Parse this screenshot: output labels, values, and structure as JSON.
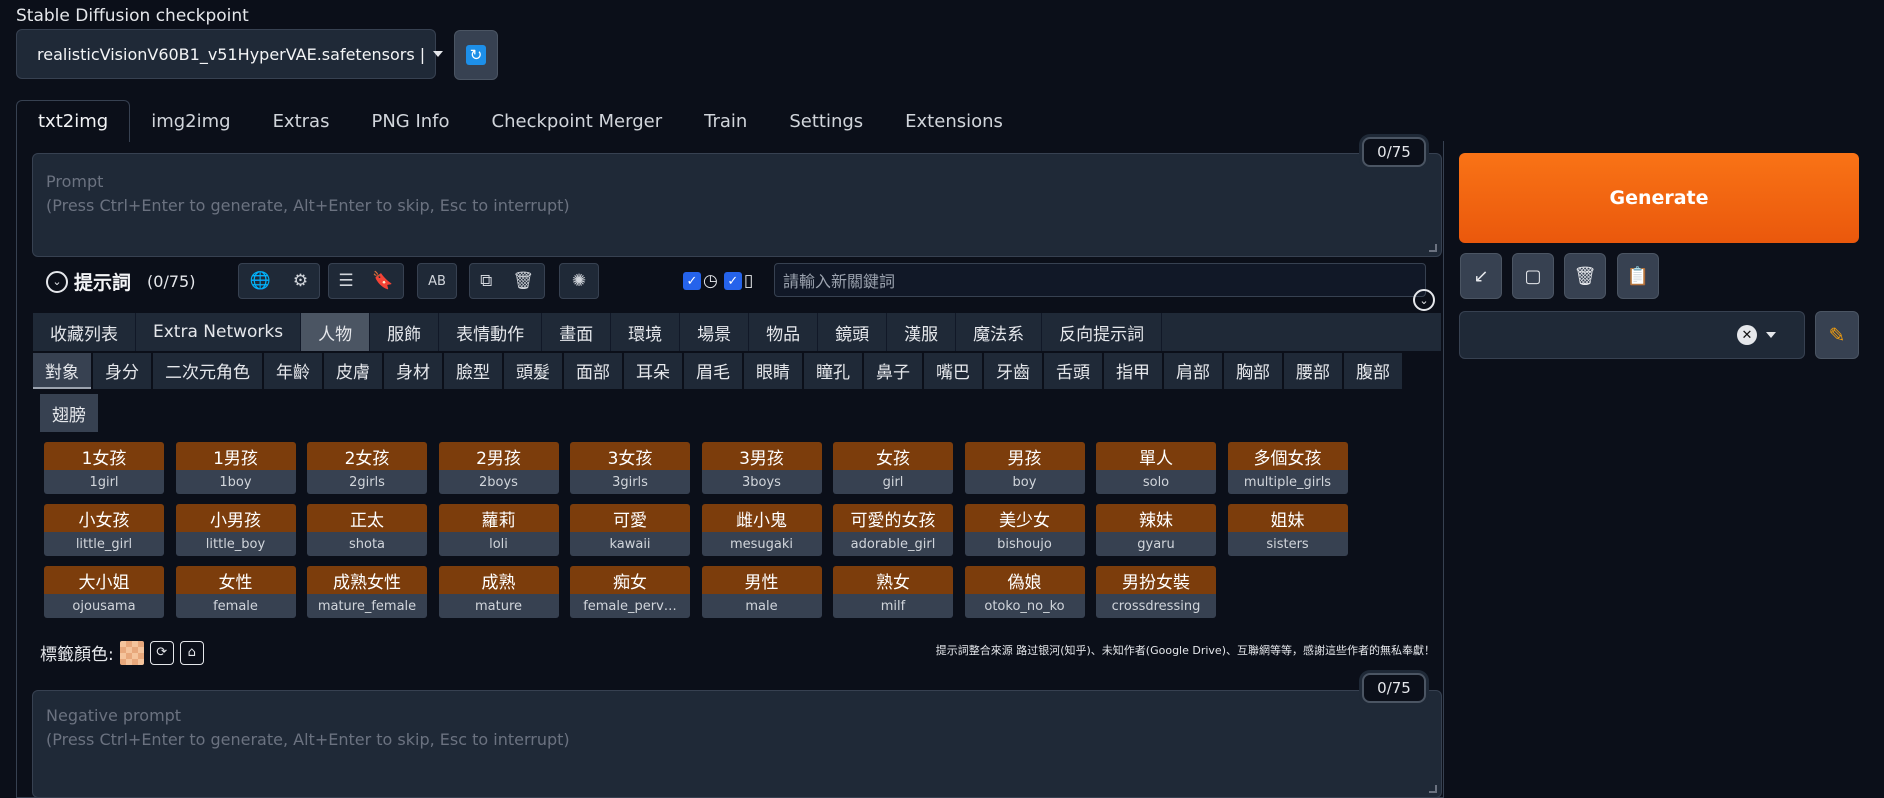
{
  "checkpoint": {
    "label": "Stable Diffusion checkpoint",
    "value": "realisticVisionV60B1_v51HyperVAE.safetensors |"
  },
  "tabs": [
    {
      "label": "txt2img",
      "active": true
    },
    {
      "label": "img2img"
    },
    {
      "label": "Extras"
    },
    {
      "label": "PNG Info"
    },
    {
      "label": "Checkpoint Merger"
    },
    {
      "label": "Train"
    },
    {
      "label": "Settings"
    },
    {
      "label": "Extensions"
    }
  ],
  "prompt": {
    "label": "Prompt",
    "hint": "(Press Ctrl+Enter to generate, Alt+Enter to skip, Esc to interrupt)",
    "counter": "0/75"
  },
  "negative_prompt": {
    "label": "Negative prompt",
    "hint": "(Press Ctrl+Enter to generate, Alt+Enter to skip, Esc to interrupt)",
    "counter": "0/75"
  },
  "generate_label": "Generate",
  "prompt_tools": {
    "title": "提示詞",
    "count": "(0/75)",
    "keyword_placeholder": "請輸入新關鍵詞"
  },
  "categories": [
    "收藏列表",
    "Extra Networks",
    "人物",
    "服飾",
    "表情動作",
    "畫面",
    "環境",
    "場景",
    "物品",
    "鏡頭",
    "漢服",
    "魔法系",
    "反向提示詞"
  ],
  "active_category": "人物",
  "subcategories": [
    "對象",
    "身分",
    "二次元角色",
    "年齡",
    "皮膚",
    "身材",
    "臉型",
    "頭髮",
    "面部",
    "耳朵",
    "眉毛",
    "眼睛",
    "瞳孔",
    "鼻子",
    "嘴巴",
    "牙齒",
    "舌頭",
    "指甲",
    "肩部",
    "胸部",
    "腰部",
    "腹部"
  ],
  "subcategory_row2": "翅膀",
  "active_subcategory": "對象",
  "tags": [
    {
      "zh": "1女孩",
      "en": "1girl"
    },
    {
      "zh": "1男孩",
      "en": "1boy"
    },
    {
      "zh": "2女孩",
      "en": "2girls"
    },
    {
      "zh": "2男孩",
      "en": "2boys"
    },
    {
      "zh": "3女孩",
      "en": "3girls"
    },
    {
      "zh": "3男孩",
      "en": "3boys"
    },
    {
      "zh": "女孩",
      "en": "girl"
    },
    {
      "zh": "男孩",
      "en": "boy"
    },
    {
      "zh": "單人",
      "en": "solo"
    },
    {
      "zh": "多個女孩",
      "en": "multiple_girls"
    },
    {
      "zh": "小女孩",
      "en": "little_girl"
    },
    {
      "zh": "小男孩",
      "en": "little_boy"
    },
    {
      "zh": "正太",
      "en": "shota"
    },
    {
      "zh": "蘿莉",
      "en": "loli"
    },
    {
      "zh": "可愛",
      "en": "kawaii"
    },
    {
      "zh": "雌小鬼",
      "en": "mesugaki"
    },
    {
      "zh": "可愛的女孩",
      "en": "adorable_girl"
    },
    {
      "zh": "美少女",
      "en": "bishoujo"
    },
    {
      "zh": "辣妹",
      "en": "gyaru"
    },
    {
      "zh": "姐妹",
      "en": "sisters"
    },
    {
      "zh": "大小姐",
      "en": "ojousama"
    },
    {
      "zh": "女性",
      "en": "female"
    },
    {
      "zh": "成熟女性",
      "en": "mature_female"
    },
    {
      "zh": "成熟",
      "en": "mature"
    },
    {
      "zh": "痴女",
      "en": "female_perv…"
    },
    {
      "zh": "男性",
      "en": "male"
    },
    {
      "zh": "熟女",
      "en": "milf"
    },
    {
      "zh": "偽娘",
      "en": "otoko_no_ko"
    },
    {
      "zh": "男扮女裝",
      "en": "crossdressing"
    }
  ],
  "tag_color_label": "標籤顏色:",
  "credit": "提示詞整合來源 路过银河(知乎)、未知作者(Google Drive)、互聯網等等，感謝這些作者的無私奉獻！",
  "colors": {
    "accent": "#ea580c",
    "tag_bg": "#7c3d0c",
    "bg": "#0b0f19",
    "panel": "#1f2937"
  }
}
